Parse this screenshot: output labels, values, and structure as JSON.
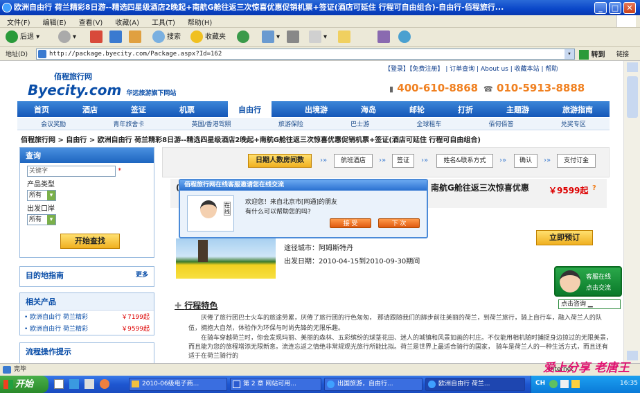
{
  "window": {
    "title": "欧洲自由行 荷兰精彩8日游--精选四星级酒店2晚起+南航G舱往返三次惊喜优惠促销机票+签证(酒店可延住 行程可自由组合)-自由行-佰程旅行..."
  },
  "menu": [
    "文件(F)",
    "编辑(E)",
    "查看(V)",
    "收藏(A)",
    "工具(T)",
    "帮助(H)"
  ],
  "toolbar": {
    "back": "后退",
    "search": "搜索",
    "favorites": "收藏夹"
  },
  "address": {
    "label": "地址(D)",
    "url": "http://package.byecity.com/Package.aspx?Id=162",
    "go": "转到",
    "links": "链接"
  },
  "site": {
    "logo_text": "佰程旅行网",
    "logo_en": "Byecity.com",
    "logo_sub": "华远旅游旗下网站",
    "top_links": "【登录】【免费注册】 | 订单查询 | About us | 收藏本站 | 帮助",
    "phone1": "400-610-8868",
    "phone2": "010-5913-8888",
    "nav": [
      "首页",
      "酒店",
      "签证",
      "机票",
      "自由行",
      "出境游",
      "海岛",
      "邮轮",
      "打折",
      "主题游",
      "旅游指南"
    ],
    "nav_active": "自由行",
    "subnav": [
      "会议奖励",
      "青年旅舍卡",
      "英国/香港驾照",
      "旅游保险",
      "巴士游",
      "全球租车",
      "佰何佰答",
      "兑奖专区"
    ],
    "breadcrumb": "佰程旅行网 > 自由行 > 欧洲自由行 荷兰精彩8日游--精选四星级酒店2晚起+南航G舱往返三次惊喜优惠促销机票+签证(酒店可延住 行程可自由组合)"
  },
  "sidebar": {
    "search_title": "查询",
    "keyword_placeholder": "关键字",
    "required_mark": "*",
    "type_label": "产品类型",
    "type_value": "所有",
    "port_label": "出发口岸",
    "port_value": "所有",
    "search_button": "开始查找",
    "guide_title": "目的地指南",
    "more": "更多",
    "related_title": "相关产品",
    "related": [
      {
        "name": "欧洲自由行 荷兰精彩",
        "price": "￥7199起"
      },
      {
        "name": "欧洲自由行 荷兰精彩",
        "price": "￥9599起"
      }
    ],
    "process_title": "流程操作提示"
  },
  "steps": [
    "日期人数房间数",
    "航班酒店",
    "签证",
    "姓名&联系方式",
    "确认",
    "支付订金"
  ],
  "product": {
    "title_visible": "南航G舱往返三次惊喜优惠",
    "title_lead": "(",
    "price": "￥9599起",
    "help": "?",
    "via": "途径城市：阿姆斯特丹",
    "date": "出发日期：2010-04-15到2010-09-30期间",
    "book": "立即预订"
  },
  "features": {
    "title": "行程特色",
    "p1": "厌倦了旅行团巴士火车的旅途劳累，厌倦了旅行团的行色匆匆， 那请跟随我们的脚步前往美丽的荷兰，到荷兰旅行，骑上自行车，融入荷兰人的队伍，拥抱大自然，体验作为环保与时尚先锋的无限乐趣。",
    "p2": "在骑车穿越荷兰时，你会发现玛丽、美丽的森林、五彩缤纷的球茎花田、迷人的城镇和风景如画的村庄。不仅能用相机随时捕捉身边掠过的无限美景，而且能为您的旅程增添无限新意。流连忘返之情绝非常规观光旅行所能比拟。荷兰是世界上最适合骑行的国家， 骑车是荷兰人的一种生活方式，而且还有适于在荷兰骑行的"
  },
  "chat": {
    "header": "佰程旅行网在线客服邀请您在线交流",
    "greeting": "欢迎您！来自北京市[网通]的朋友",
    "question": "有什么可以帮助您的吗?",
    "accept": "接 受",
    "reject": "下 次",
    "badge": "在线"
  },
  "service": {
    "line1": "客服在线",
    "line2": "点击交流",
    "consult": "点击咨询"
  },
  "status": {
    "text": "完毕",
    "zone": "Internet"
  },
  "taskbar": {
    "start": "开始",
    "tasks": [
      "2010-06级电子商...",
      "第 2 章 网站可用...",
      "出国旅游，自由行...",
      "欧洲自由行 荷兰..."
    ],
    "ime": "CH",
    "time": "16:35"
  },
  "watermark": "爱上分享 老唐王"
}
